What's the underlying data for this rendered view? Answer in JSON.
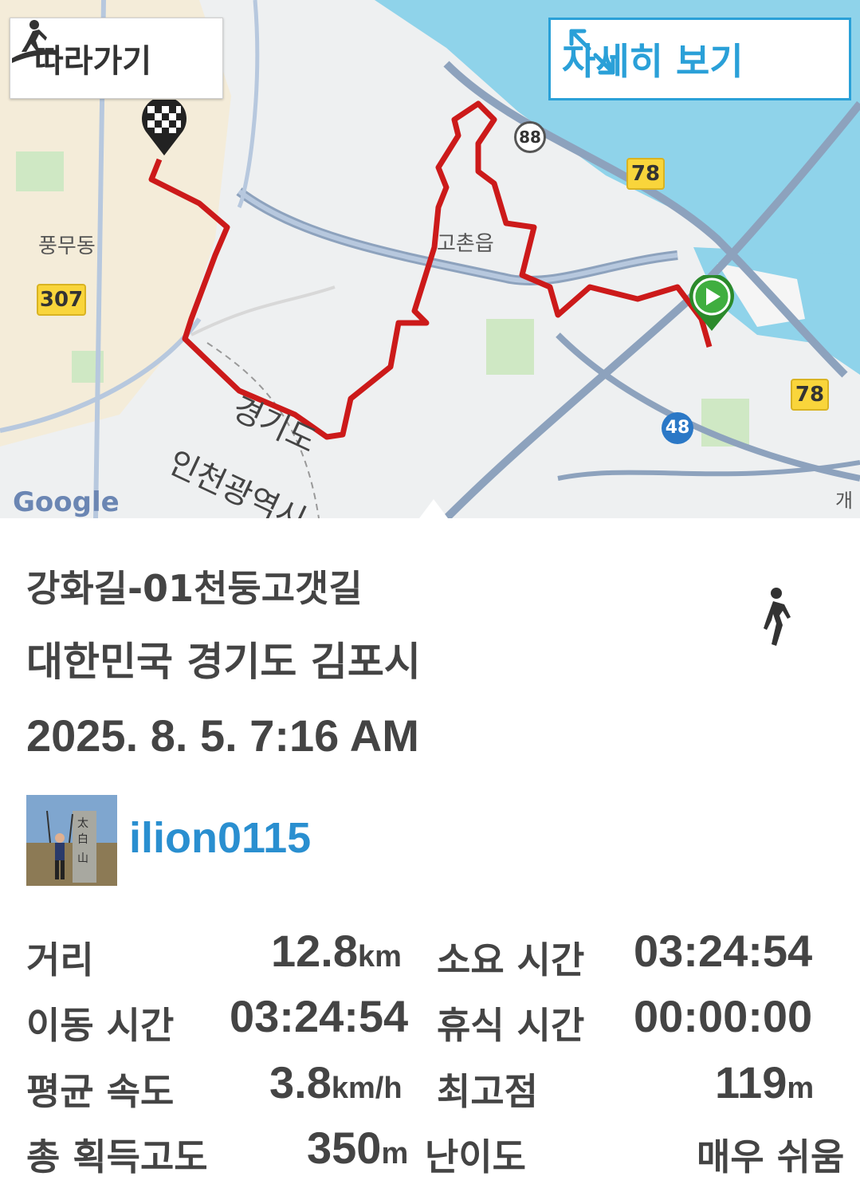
{
  "map": {
    "follow_button": "따라가기",
    "detail_button": "자세히 보기",
    "labels": {
      "pungmu": "풍무동",
      "gochon": "고촌읍",
      "gyeonggi": "경기도",
      "incheon": "인천광역시",
      "gaehwa": "개화",
      "google": "Google"
    },
    "road_badges": [
      "307",
      "78",
      "78"
    ],
    "highway_badges": [
      "88",
      "48"
    ],
    "route_color": "#cc1a1a"
  },
  "track": {
    "title": "강화길-01천둥고갯길",
    "region": "대한민국 경기도 김포시",
    "datetime": "2025. 8. 5. 7:16 AM",
    "activity_icon": "walking-person-icon"
  },
  "user": {
    "username": "ilion0115"
  },
  "stats": {
    "distance": {
      "label": "거리",
      "value": "12.8",
      "unit": "km"
    },
    "duration": {
      "label": "소요 시간",
      "value": "03:24:54"
    },
    "moving_time": {
      "label": "이동 시간",
      "value": "03:24:54"
    },
    "rest_time": {
      "label": "휴식 시간",
      "value": "00:00:00"
    },
    "avg_speed": {
      "label": "평균 속도",
      "value": "3.8",
      "unit": "km/h"
    },
    "max_elevation": {
      "label": "최고점",
      "value": "119",
      "unit": "m"
    },
    "total_ascent": {
      "label": "총 획득고도",
      "value": "350",
      "unit": "m"
    },
    "difficulty": {
      "label": "난이도",
      "value": "매우 쉬움"
    }
  }
}
